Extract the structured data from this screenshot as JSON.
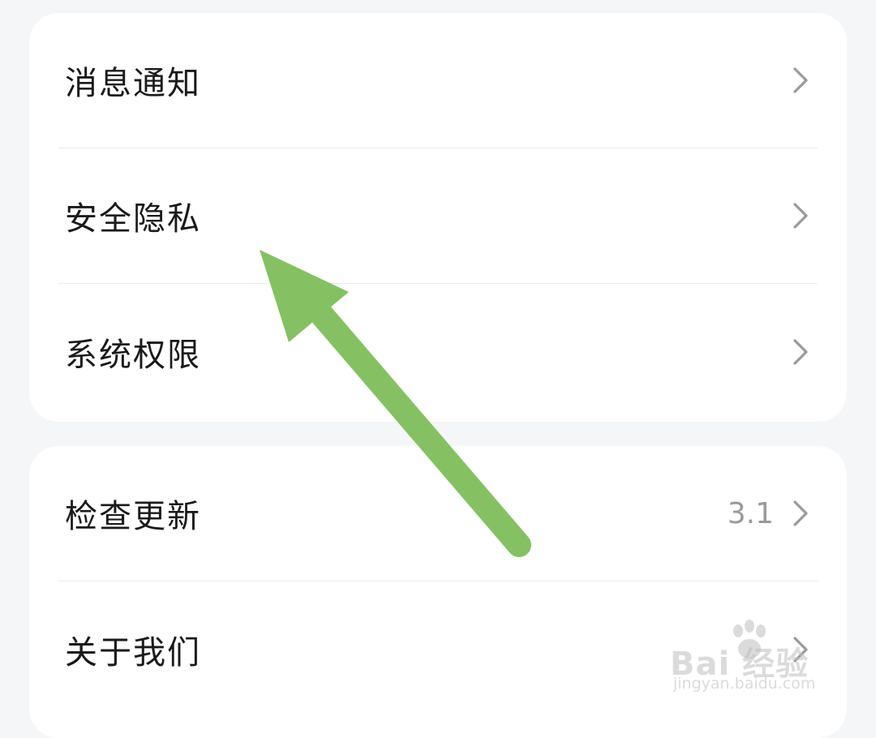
{
  "settings": {
    "groups": [
      {
        "items": [
          {
            "label": "消息通知"
          },
          {
            "label": "安全隐私"
          },
          {
            "label": "系统权限"
          }
        ]
      },
      {
        "items": [
          {
            "label": "检查更新",
            "value": "3.1"
          },
          {
            "label": "关于我们"
          }
        ]
      }
    ]
  },
  "icons": {
    "row_chevron": "chevron-right-icon",
    "annotation_arrow": "arrow-icon"
  },
  "colors": {
    "background": "#f5f6f8",
    "card": "#ffffff",
    "arrow": "#85c163",
    "chevron": "#9a9a9a"
  },
  "watermark": {
    "brand": "Bai  经验",
    "url": "jingyan.baidu.com"
  }
}
